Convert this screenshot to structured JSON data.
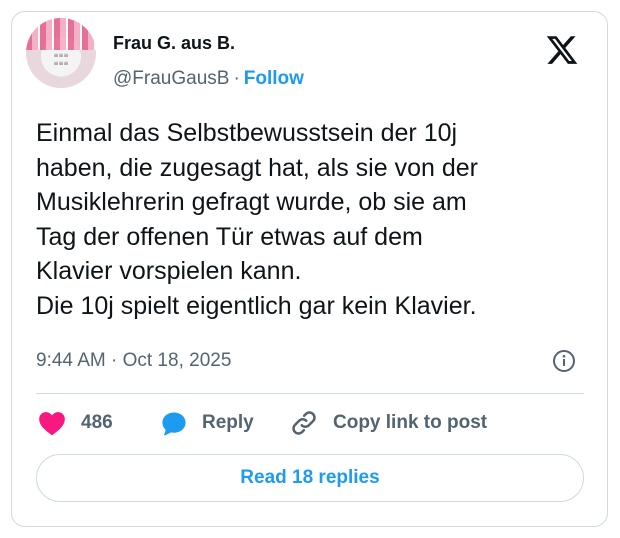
{
  "author": {
    "name": "Frau G. aus B.",
    "handle": "@FrauGausB",
    "separator": "·",
    "follow_label": "Follow",
    "avatar_icon": "profile-avatar-mug"
  },
  "logo": "x-logo-icon",
  "post": {
    "text": "Einmal das Selbstbewusstsein der 10j\nhaben, die zugesagt hat, als sie von der\nMusiklehrerin gefragt wurde, ob sie am\nTag der offenen Tür etwas auf dem\nKlavier vorspielen kann.\nDie 10j spielt eigentlich gar kein Klavier.",
    "timestamp": "9:44 AM · Oct 18, 2025"
  },
  "actions": {
    "like_count": "486",
    "reply_label": "Reply",
    "copy_label": "Copy link to post",
    "read_replies_label": "Read 18 replies"
  },
  "colors": {
    "accent": "#1d9bf0",
    "like": "#f91880",
    "secondary_text": "#536471",
    "border": "#cfd9de"
  }
}
